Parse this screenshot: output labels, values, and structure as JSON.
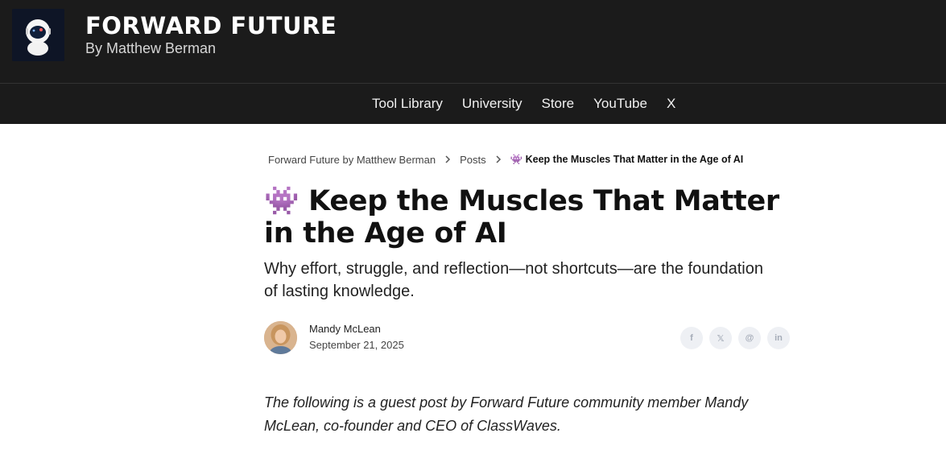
{
  "header": {
    "brand_title": "FORWARD FUTURE",
    "brand_subtitle": "By Matthew Berman",
    "logo_icon": "astronaut-icon",
    "background": "#1b1b1b"
  },
  "nav": {
    "items": [
      {
        "label": "Tool Library"
      },
      {
        "label": "University"
      },
      {
        "label": "Store"
      },
      {
        "label": "YouTube"
      },
      {
        "label": "X"
      }
    ]
  },
  "breadcrumb": {
    "home": "Forward Future by Matthew Berman",
    "section": "Posts",
    "current": "👾 Keep the Muscles That Matter in the Age of AI",
    "separator_icon": "chevron-right-icon"
  },
  "article": {
    "title": "👾 Keep the Muscles That Matter in the Age of AI",
    "subtitle": "Why effort, struggle, and reflection—not shortcuts—are the foundation of lasting knowledge.",
    "author": "Mandy McLean",
    "date": "September 21, 2025",
    "intro": "The following is a guest post by Forward Future community member Mandy McLean, co-founder and CEO of ClassWaves."
  },
  "share": {
    "icons": [
      "facebook-icon",
      "x-icon",
      "threads-icon",
      "linkedin-icon"
    ],
    "glyphs": [
      "f",
      "𝕏",
      "@",
      "in"
    ]
  }
}
